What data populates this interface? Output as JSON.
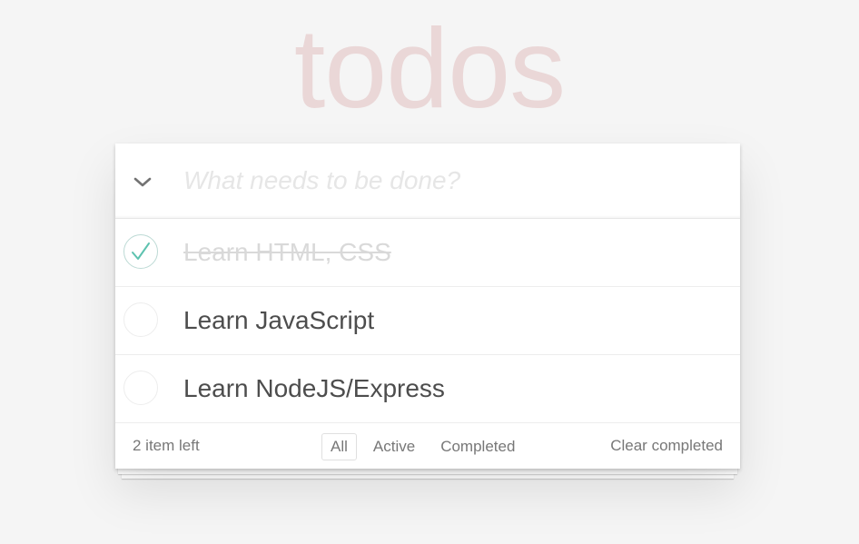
{
  "app": {
    "title": "todos"
  },
  "new_todo": {
    "placeholder": "What needs to be done?",
    "value": ""
  },
  "todos": [
    {
      "label": "Learn HTML, CSS",
      "completed": true
    },
    {
      "label": "Learn JavaScript",
      "completed": false
    },
    {
      "label": "Learn NodeJS/Express",
      "completed": false
    }
  ],
  "footer": {
    "count_text": "2 item left",
    "filters": [
      {
        "label": "All",
        "selected": true
      },
      {
        "label": "Active",
        "selected": false
      },
      {
        "label": "Completed",
        "selected": false
      }
    ],
    "clear_label": "Clear completed"
  },
  "icons": {
    "toggle_all": "chevron-down-icon",
    "completed_toggle": "check-circle-icon",
    "incomplete_toggle": "empty-circle-icon"
  },
  "colors": {
    "title": "#efd5d5",
    "check": "#5dc2af",
    "background": "#f5f5f5"
  }
}
